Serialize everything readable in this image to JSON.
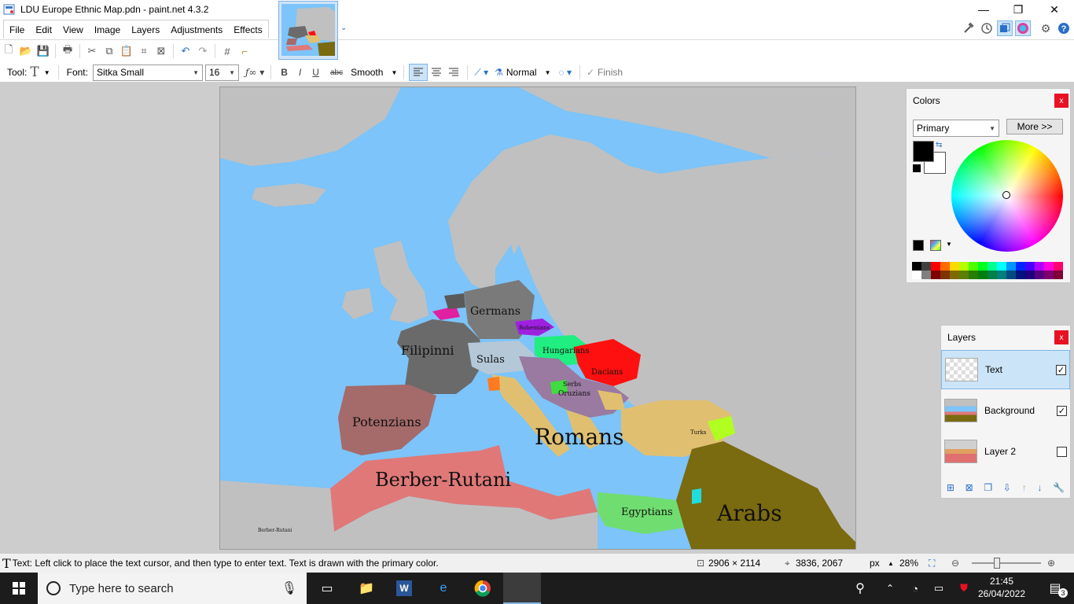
{
  "window": {
    "title": "LDU Europe Ethnic Map.pdn - paint.net 4.3.2",
    "controls": {
      "minimize": "—",
      "restore": "❐",
      "close": "✕"
    }
  },
  "menu": [
    "File",
    "Edit",
    "View",
    "Image",
    "Layers",
    "Adjustments",
    "Effects"
  ],
  "toolbar": {
    "tool_label": "Tool:",
    "tool_icon": "T",
    "font_label": "Font:",
    "font_value": "Sitka Small",
    "size_value": "16",
    "antialias_value": "Smooth",
    "blend_value": "Normal",
    "finish_label": "Finish",
    "bold": "B",
    "italic": "I",
    "underline": "U",
    "strike": "abc"
  },
  "map_labels": [
    {
      "id": "germans",
      "text": "Germans"
    },
    {
      "id": "filipinni",
      "text": "Filipinni"
    },
    {
      "id": "sulas",
      "text": "Sulas"
    },
    {
      "id": "hungarians",
      "text": "Hungarians"
    },
    {
      "id": "dacians",
      "text": "Dacians"
    },
    {
      "id": "serbs",
      "text": "Serbs"
    },
    {
      "id": "oruzians",
      "text": "Oruzians"
    },
    {
      "id": "bohemians",
      "text": "Bohemians"
    },
    {
      "id": "potenzians",
      "text": "Potenzians"
    },
    {
      "id": "romans",
      "text": "Romans"
    },
    {
      "id": "turks",
      "text": "Turks"
    },
    {
      "id": "berber",
      "text": "Berber-Rutani"
    },
    {
      "id": "egyptians",
      "text": "Egyptians"
    },
    {
      "id": "arabs",
      "text": "Arabs"
    },
    {
      "id": "berber_small",
      "text": "Berber-Rutani"
    }
  ],
  "colors_panel": {
    "title": "Colors",
    "close": "x",
    "mode_value": "Primary",
    "more_label": "More >>",
    "primary_color": "#000000",
    "secondary_color": "#ffffff"
  },
  "palette": [
    "#000000",
    "#404040",
    "#ff0000",
    "#ff6a00",
    "#ffd800",
    "#b6ff00",
    "#4cff00",
    "#00ff21",
    "#00ff90",
    "#00ffff",
    "#0094ff",
    "#0026ff",
    "#4800ff",
    "#b200ff",
    "#ff00dc",
    "#ff006e",
    "#ffffff",
    "#808080",
    "#7f0000",
    "#7f3300",
    "#7f6a00",
    "#5b7f00",
    "#267f00",
    "#007f0e",
    "#007f46",
    "#007f7f",
    "#004a7f",
    "#00137f",
    "#21007f",
    "#57007f",
    "#7f006e",
    "#7f0037"
  ],
  "layers_panel": {
    "title": "Layers",
    "close": "x",
    "layers": [
      {
        "name": "Text",
        "visible": true,
        "selected": true
      },
      {
        "name": "Background",
        "visible": true,
        "selected": false
      },
      {
        "name": "Layer 2",
        "visible": false,
        "selected": false
      }
    ]
  },
  "status": {
    "hint": "Text: Left click to place the text cursor, and then type to enter text. Text is drawn with the primary color.",
    "image_size": "2906 × 2114",
    "cursor_pos": "3836, 2067",
    "units": "px",
    "zoom": "28%"
  },
  "taskbar": {
    "search_placeholder": "Type here to search",
    "time": "21:45",
    "date": "26/04/2022",
    "notification_count": "3"
  }
}
